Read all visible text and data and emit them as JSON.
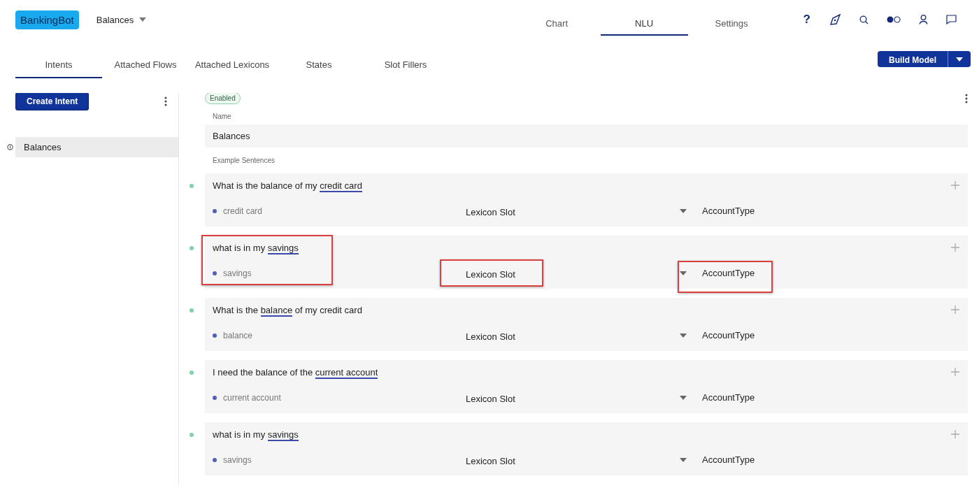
{
  "app": {
    "bot_name": "BankingBot",
    "intent_menu": "Balances"
  },
  "top_tabs": [
    {
      "label": "Chart",
      "selected": false
    },
    {
      "label": "NLU",
      "selected": true
    },
    {
      "label": "Settings",
      "selected": false
    }
  ],
  "help_label": "?",
  "sub_tabs": [
    {
      "label": "Intents",
      "selected": true
    },
    {
      "label": "Attached Flows",
      "selected": false
    },
    {
      "label": "Attached Lexicons",
      "selected": false
    },
    {
      "label": "States",
      "selected": false
    },
    {
      "label": "Slot Fillers",
      "selected": false
    }
  ],
  "build_button": "Build Model",
  "sidebar": {
    "create_button": "Create Intent",
    "items": [
      {
        "label": "Balances",
        "selected": true
      }
    ]
  },
  "intent": {
    "status": "Enabled",
    "name_label": "Name",
    "name_value": "Balances",
    "sentences_label": "Example Sentences"
  },
  "sentences": [
    {
      "before": "What is the balance of my ",
      "slot_text": "credit card",
      "slot_value": "credit card",
      "slot_type": "Lexicon Slot",
      "lexicon": "AccountType",
      "highlighted": false
    },
    {
      "before": "what is in my ",
      "slot_text": "savings",
      "slot_value": "savings",
      "slot_type": "Lexicon Slot",
      "lexicon": "AccountType",
      "highlighted": true
    },
    {
      "before": "What is the ",
      "slot_text": "balance",
      "after": " of my credit card",
      "slot_value": "balance",
      "slot_type": "Lexicon Slot",
      "lexicon": "AccountType",
      "highlighted": false
    },
    {
      "before": "I need the balance of the ",
      "slot_text": "current account",
      "slot_value": "current account",
      "slot_type": "Lexicon Slot",
      "lexicon": "AccountType",
      "highlighted": false
    },
    {
      "before": "what is in my ",
      "slot_text": "savings",
      "slot_value": "savings",
      "slot_type": "Lexicon Slot",
      "lexicon": "AccountType",
      "highlighted": false
    }
  ]
}
